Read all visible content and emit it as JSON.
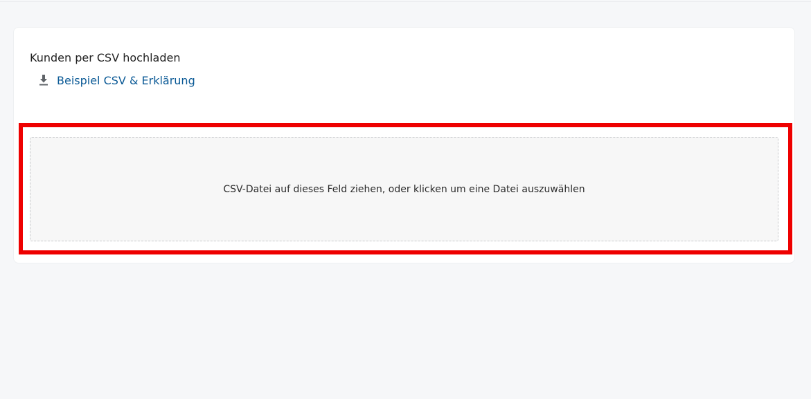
{
  "upload_card": {
    "title": "Kunden per CSV hochladen",
    "sample_link_label": "Beispiel CSV & Erklärung",
    "sample_link_icon": "download-icon",
    "dropzone_text": "CSV-Datei auf dieses Feld ziehen, oder klicken um eine Datei auszuwählen"
  },
  "colors": {
    "link": "#0b5a96",
    "highlight_border": "#ee0000",
    "dropzone_bg": "#f7f7f7",
    "page_bg": "#f6f7f9"
  }
}
